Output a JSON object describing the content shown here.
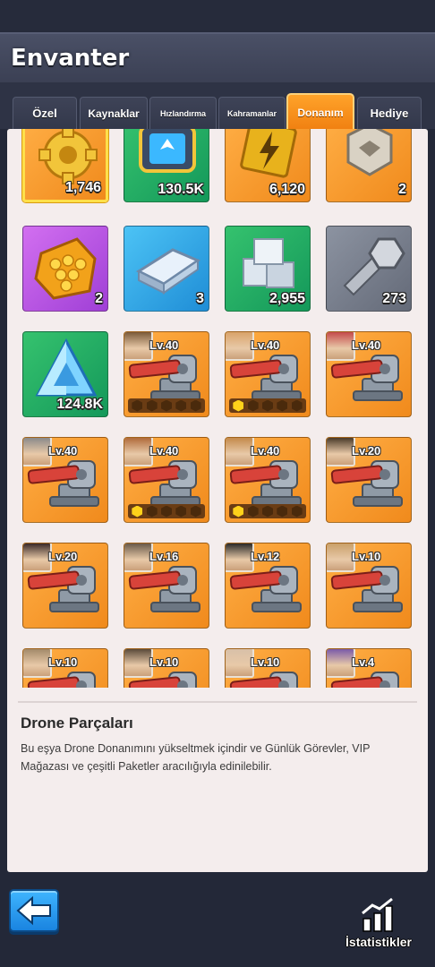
{
  "header": {
    "title": "Envanter"
  },
  "tabs": [
    {
      "label": "Özel",
      "active": false
    },
    {
      "label": "Kaynaklar",
      "active": false
    },
    {
      "label": "Hızlandırma",
      "active": false
    },
    {
      "label": "Kahramanlar",
      "active": false
    },
    {
      "label": "Donanım",
      "active": true
    },
    {
      "label": "Hediye",
      "active": false
    }
  ],
  "items": [
    {
      "icon": "gear-icon",
      "qty": "1,746",
      "selected": true
    },
    {
      "icon": "drone-chip-icon",
      "qty": "130.5K"
    },
    {
      "icon": "energy-card-icon",
      "qty": "6,120"
    },
    {
      "icon": "emblem-icon",
      "qty": "2"
    },
    {
      "icon": "honeycomb-icon",
      "qty": "2"
    },
    {
      "icon": "metal-bar-icon",
      "qty": "3"
    },
    {
      "icon": "alloy-blocks-icon",
      "qty": "2,955"
    },
    {
      "icon": "bolt-screw-icon",
      "qty": "273"
    },
    {
      "icon": "crystal-icon",
      "qty": "124.8K"
    }
  ],
  "gear_items": [
    {
      "level": "Lv.40",
      "stars_filled": 0
    },
    {
      "level": "Lv.40",
      "stars_filled": 1
    },
    {
      "level": "Lv.40"
    },
    {
      "level": "Lv.40"
    },
    {
      "level": "Lv.40",
      "stars_filled": 1
    },
    {
      "level": "Lv.40",
      "stars_filled": 1
    },
    {
      "level": "Lv.20"
    },
    {
      "level": "Lv.20"
    },
    {
      "level": "Lv.16"
    },
    {
      "level": "Lv.12"
    },
    {
      "level": "Lv.10"
    },
    {
      "level": "Lv.10"
    },
    {
      "level": "Lv.10"
    },
    {
      "level": "Lv.10"
    },
    {
      "level": "Lv.4"
    }
  ],
  "detail": {
    "title": "Drone Parçaları",
    "description": "Bu eşya Drone Donanımını yükseltmek içindir ve Günlük Görevler, VIP Mağazası ve çeşitli Paketler aracılığıyla edinilebilir."
  },
  "footer": {
    "back_icon": "back-arrow-icon",
    "stats_label": "İstatistikler",
    "stats_icon": "statistics-icon"
  }
}
